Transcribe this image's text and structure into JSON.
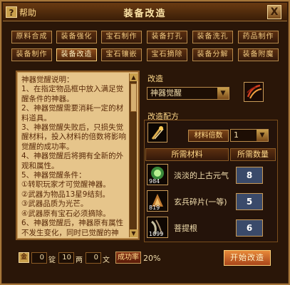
{
  "window": {
    "help_label": "帮助",
    "help_q": "?",
    "title": "装备改造",
    "close": "X"
  },
  "tabs": [
    {
      "label": "原料合成"
    },
    {
      "label": "装备强化"
    },
    {
      "label": "宝石制作"
    },
    {
      "label": "装备打孔"
    },
    {
      "label": "装备洗孔"
    },
    {
      "label": "药品制作"
    },
    {
      "label": "装备制作"
    },
    {
      "label": "装备改造",
      "active": true
    },
    {
      "label": "宝石镶嵌"
    },
    {
      "label": "宝石摘除"
    },
    {
      "label": "装备分解"
    },
    {
      "label": "装备附魔"
    }
  ],
  "description": {
    "lines": [
      "神器觉醒说明：",
      "1、在指定物品框中放入满足觉醒条件的神器。",
      "2、神器觉醒需要消耗一定的材料道具。",
      "3、神器觉醒失败后，只损失觉醒材料，投入材料的倍数将影响觉醒的成功率。",
      "4、神器觉醒后将拥有全新的外观和属性。",
      "5、神器觉醒条件：",
      "①转职玩家才可觉醒神器。",
      "②武器为物品13星9结刻。",
      "③武器品质为光芒。",
      "④武器原有宝石必须摘除。",
      "6、神器觉醒后，神器原有属性不发生变化，同时已觉醒的神"
    ]
  },
  "reform": {
    "label": "改造",
    "selected": "神器觉醒",
    "recipe_label": "改造配方",
    "multiplier_label": "材料倍数",
    "multiplier_value": "1",
    "col_material": "所需材料",
    "col_qty": "所需数量",
    "materials": [
      {
        "name": "淡淡的上古元气",
        "count": "984",
        "qty": "8"
      },
      {
        "name": "玄兵碎片(一等)",
        "count": "819",
        "qty": "5"
      },
      {
        "name": "菩提根",
        "count": "1099",
        "qty": "6"
      }
    ]
  },
  "cost": {
    "gold_icon": "金",
    "gold": "0",
    "gold_unit": "锭",
    "silver": "10",
    "silver_unit": "两",
    "copper": "0",
    "copper_unit": "文",
    "rate_label": "成功率",
    "rate_value": "20%"
  },
  "start_button": "开始改造"
}
